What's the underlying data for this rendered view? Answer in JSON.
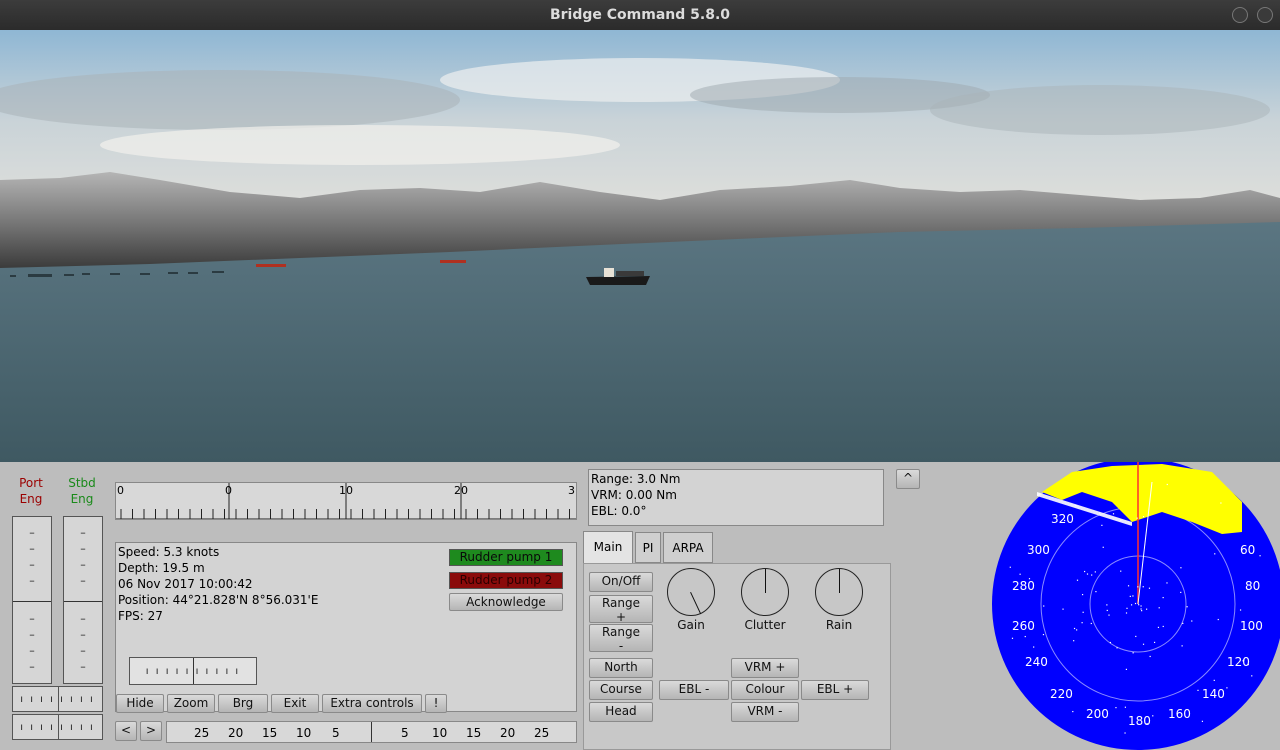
{
  "window": {
    "title": "Bridge Command 5.8.0"
  },
  "engines": {
    "port_label": "Port\nEng",
    "stbd_label": "Stbd\nEng",
    "port_color": "#9b0000",
    "stbd_color": "#1a8a1a"
  },
  "compass_strip": {
    "labels": [
      "0",
      "0",
      "10",
      "20",
      "3"
    ]
  },
  "info": {
    "speed": "Speed: 5.3 knots",
    "depth": "Depth: 19.5 m",
    "datetime": "06 Nov 2017 10:00:42",
    "position": "Position: 44°21.828'N 8°56.031'E",
    "fps": "FPS: 27"
  },
  "alarms": {
    "pump1": {
      "label": "Rudder pump 1",
      "color": "#1e8a1e"
    },
    "pump2": {
      "label": "Rudder pump 2",
      "color": "#8a0b0b"
    },
    "acknowledge": "Acknowledge"
  },
  "bottom_buttons": {
    "hide": "Hide",
    "zoom": "Zoom",
    "brg": "Brg",
    "exit": "Exit",
    "extra": "Extra controls",
    "alert": "!"
  },
  "rudder_strip": {
    "left_arrow": "<",
    "right_arrow": ">",
    "labels": [
      "25",
      "20",
      "15",
      "10",
      "5",
      "5",
      "10",
      "15",
      "20",
      "25"
    ]
  },
  "radar_readout": {
    "range": "Range: 3.0 Nm",
    "vrm": "VRM: 0.00 Nm",
    "ebl": "EBL: 0.0°"
  },
  "radar_toggle": "^",
  "tabs": {
    "main": "Main",
    "pi": "PI",
    "arpa": "ARPA"
  },
  "radar_controls": {
    "onoff": "On/Off",
    "range_plus": "Range\n+",
    "range_minus": "Range\n-",
    "north": "North",
    "course": "Course",
    "head": "Head",
    "ebl_minus": "EBL -",
    "ebl_plus": "EBL +",
    "vrm_plus": "VRM +",
    "vrm_minus": "VRM -",
    "colour": "Colour",
    "gain": "Gain",
    "clutter": "Clutter",
    "rain": "Rain"
  },
  "radar_display": {
    "bearings": [
      "320",
      "300",
      "280",
      "260",
      "240",
      "220",
      "200",
      "180",
      "160",
      "140",
      "120",
      "100",
      "80",
      "60"
    ],
    "background_color": "#0000ff",
    "echo_color": "#ffff00"
  }
}
